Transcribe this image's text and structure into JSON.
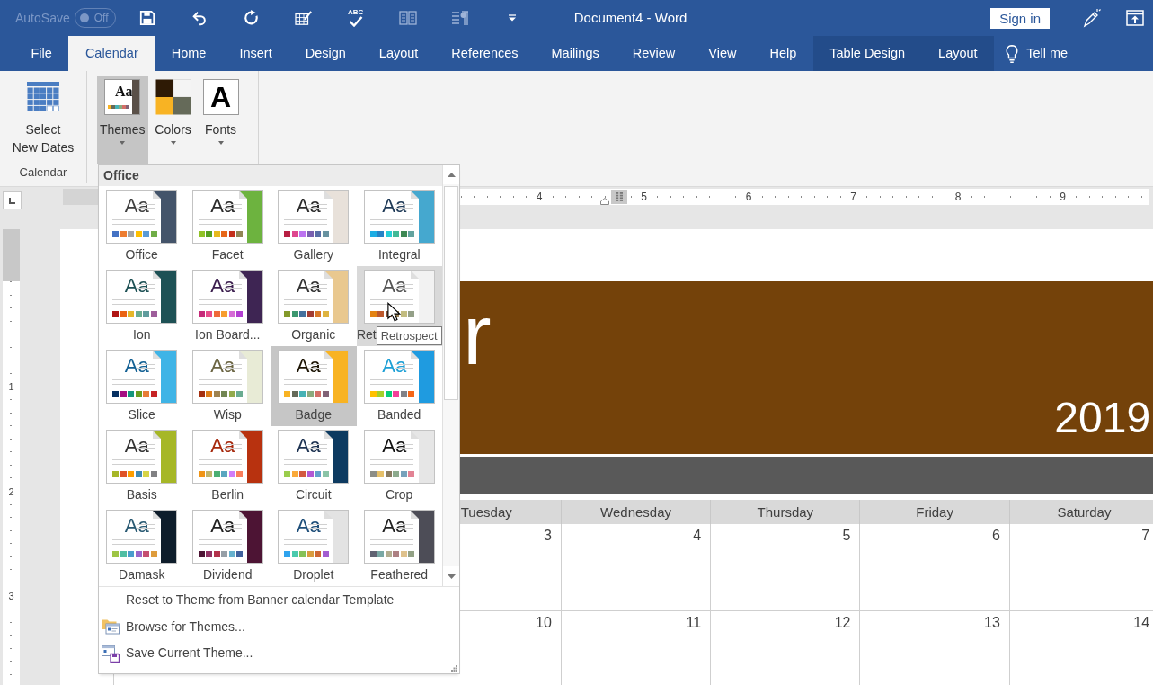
{
  "title_bar": {
    "autosave": {
      "label": "AutoSave",
      "state_text": "Off",
      "on": false,
      "disabled": true
    },
    "quick_access": [
      {
        "kind": "save",
        "disabled": false
      },
      {
        "kind": "undo",
        "disabled": false
      },
      {
        "kind": "redo",
        "disabled": false
      },
      {
        "kind": "draw-table",
        "disabled": false
      },
      {
        "kind": "spelling",
        "text": "ABC",
        "disabled": false
      },
      {
        "kind": "reading-mode",
        "disabled": true
      },
      {
        "kind": "paragraph",
        "disabled": true
      },
      {
        "kind": "customize",
        "disabled": false
      }
    ],
    "title": "Document4 - Word",
    "sign_in": "Sign in"
  },
  "tabs": [
    {
      "label": "File",
      "selected": false,
      "contextual": false
    },
    {
      "label": "Calendar",
      "selected": true,
      "contextual": false
    },
    {
      "label": "Home",
      "selected": false,
      "contextual": false
    },
    {
      "label": "Insert",
      "selected": false,
      "contextual": false
    },
    {
      "label": "Design",
      "selected": false,
      "contextual": false
    },
    {
      "label": "Layout",
      "selected": false,
      "contextual": false
    },
    {
      "label": "References",
      "selected": false,
      "contextual": false
    },
    {
      "label": "Mailings",
      "selected": false,
      "contextual": false
    },
    {
      "label": "Review",
      "selected": false,
      "contextual": false
    },
    {
      "label": "View",
      "selected": false,
      "contextual": false
    },
    {
      "label": "Help",
      "selected": false,
      "contextual": false
    },
    {
      "label": "Table Design",
      "selected": false,
      "contextual": true
    },
    {
      "label": "Layout",
      "selected": false,
      "contextual": true
    }
  ],
  "tell_me": "Tell me",
  "ribbon": {
    "groups": [
      {
        "label": "Calendar",
        "buttons": [
          {
            "kind": "calendar",
            "label": "Select\nNew Dates",
            "selected": false,
            "dropdown": false
          }
        ]
      },
      {
        "buttons": [
          {
            "kind": "themes",
            "label": "Themes",
            "icon_text": "Aa",
            "selected": true,
            "dropdown": true
          },
          {
            "kind": "colors",
            "label": "Colors",
            "selected": false,
            "dropdown": true
          },
          {
            "kind": "fonts",
            "label": "Fonts",
            "icon_text": "A",
            "selected": false,
            "dropdown": true
          }
        ]
      }
    ]
  },
  "rulers": {
    "horizontal": [
      "4",
      "5",
      "6",
      "7",
      "8",
      "9"
    ],
    "vertical": [
      "1",
      "2",
      "3"
    ]
  },
  "document": {
    "calendar": {
      "month_title": "r",
      "year": "2019",
      "weekdays": [
        "Tuesday",
        "Wednesday",
        "Thursday",
        "Friday",
        "Saturday"
      ],
      "weeks": [
        [
          "3",
          "4",
          "5",
          "6",
          "7"
        ],
        [
          "10",
          "11",
          "12",
          "13",
          "14"
        ]
      ]
    }
  },
  "themes_menu": {
    "section": "Office",
    "themes": [
      {
        "name": "Office",
        "sample": {
          "text": "Aa",
          "color": "#404040"
        },
        "accent": {
          "color": "#44546a"
        },
        "swatches": [
          {
            "color": "#4472c4"
          },
          {
            "color": "#ed7d31"
          },
          {
            "color": "#a5a5a5"
          },
          {
            "color": "#ffc000"
          },
          {
            "color": "#5b9bd5"
          },
          {
            "color": "#70ad47"
          }
        ],
        "selected": false,
        "hovered": false
      },
      {
        "name": "Facet",
        "sample": {
          "text": "Aa",
          "color": "#2c2c2c"
        },
        "accent": {
          "color": "#6db33f"
        },
        "swatches": [
          {
            "color": "#90c226"
          },
          {
            "color": "#54a021"
          },
          {
            "color": "#e6b91e"
          },
          {
            "color": "#e76618"
          },
          {
            "color": "#c42f1a"
          },
          {
            "color": "#918655"
          }
        ],
        "selected": false,
        "hovered": false
      },
      {
        "name": "Gallery",
        "sample": {
          "text": "Aa",
          "color": "#2c2c2c"
        },
        "accent": {
          "color": "#e8e1da"
        },
        "swatches": [
          {
            "color": "#b71e42"
          },
          {
            "color": "#de478e"
          },
          {
            "color": "#bc72f0"
          },
          {
            "color": "#795faf"
          },
          {
            "color": "#586ea6"
          },
          {
            "color": "#6892a0"
          }
        ],
        "selected": false,
        "hovered": false
      },
      {
        "name": "Integral",
        "sample": {
          "text": "Aa",
          "color": "#1f3a57"
        },
        "accent": {
          "color": "#45a8cf"
        },
        "swatches": [
          {
            "color": "#1cade4"
          },
          {
            "color": "#2683c6"
          },
          {
            "color": "#27ced7"
          },
          {
            "color": "#42ba97"
          },
          {
            "color": "#3e8853"
          },
          {
            "color": "#62a39f"
          }
        ],
        "selected": false,
        "hovered": false
      },
      {
        "name": "Ion",
        "sample": {
          "text": "Aa",
          "color": "#1e5155"
        },
        "accent": {
          "color": "#1e5155"
        },
        "swatches": [
          {
            "color": "#b01513"
          },
          {
            "color": "#ea6312"
          },
          {
            "color": "#e6b729"
          },
          {
            "color": "#6aac90"
          },
          {
            "color": "#5f9c9d"
          },
          {
            "color": "#9e5e9b"
          }
        ],
        "selected": false,
        "hovered": false
      },
      {
        "name": "Ion Board...",
        "sample": {
          "text": "Aa",
          "color": "#3b1e4e"
        },
        "accent": {
          "color": "#3e2553"
        },
        "swatches": [
          {
            "color": "#c62a79"
          },
          {
            "color": "#e84c8b"
          },
          {
            "color": "#ef6a3a"
          },
          {
            "color": "#f79d2e"
          },
          {
            "color": "#d66bd6"
          },
          {
            "color": "#b33fd2"
          }
        ],
        "selected": false,
        "hovered": false
      },
      {
        "name": "Organic",
        "sample": {
          "text": "Aa",
          "color": "#333333"
        },
        "accent": {
          "color": "#e9c88f"
        },
        "swatches": [
          {
            "color": "#83992a"
          },
          {
            "color": "#3c9770"
          },
          {
            "color": "#44709d"
          },
          {
            "color": "#a23c33"
          },
          {
            "color": "#d97828"
          },
          {
            "color": "#deb340"
          }
        ],
        "selected": false,
        "hovered": false
      },
      {
        "name": "Ret",
        "sample": {
          "text": "Aa",
          "color": "#555555"
        },
        "accent": {
          "color": "#f2f2f2"
        },
        "swatches": [
          {
            "color": "#e48312"
          },
          {
            "color": "#bd582c"
          },
          {
            "color": "#865640"
          },
          {
            "color": "#9b8357"
          },
          {
            "color": "#c2bc80"
          },
          {
            "color": "#94a088"
          }
        ],
        "selected": false,
        "hovered": true
      },
      {
        "name": "Slice",
        "sample": {
          "text": "Aa",
          "color": "#146194"
        },
        "accent": {
          "color": "#3fb4e6"
        },
        "swatches": [
          {
            "color": "#052f61"
          },
          {
            "color": "#a50e82"
          },
          {
            "color": "#14967c"
          },
          {
            "color": "#6a9e1f"
          },
          {
            "color": "#e87d37"
          },
          {
            "color": "#c62324"
          }
        ],
        "selected": false,
        "hovered": false
      },
      {
        "name": "Wisp",
        "sample": {
          "text": "Aa",
          "color": "#6b6543"
        },
        "accent": {
          "color": "#e8ebd6"
        },
        "swatches": [
          {
            "color": "#a53010"
          },
          {
            "color": "#de7e18"
          },
          {
            "color": "#9f8351"
          },
          {
            "color": "#728653"
          },
          {
            "color": "#92aa4c"
          },
          {
            "color": "#6aac91"
          }
        ],
        "selected": false,
        "hovered": false
      },
      {
        "name": "Badge",
        "sample": {
          "text": "Aa",
          "color": "#1c1404"
        },
        "accent": {
          "color": "#f8b323"
        },
        "swatches": [
          {
            "color": "#f8b323"
          },
          {
            "color": "#656a59"
          },
          {
            "color": "#46b2b5"
          },
          {
            "color": "#8caa7e"
          },
          {
            "color": "#d36f68"
          },
          {
            "color": "#826276"
          }
        ],
        "selected": true,
        "hovered": false
      },
      {
        "name": "Banded",
        "sample": {
          "text": "Aa",
          "color": "#1ea0d6"
        },
        "accent": {
          "color": "#1f9be0"
        },
        "swatches": [
          {
            "color": "#ffc000"
          },
          {
            "color": "#a5d028"
          },
          {
            "color": "#08cc78"
          },
          {
            "color": "#f24099"
          },
          {
            "color": "#828288"
          },
          {
            "color": "#f56617"
          }
        ],
        "selected": false,
        "hovered": false
      },
      {
        "name": "Basis",
        "sample": {
          "text": "Aa",
          "color": "#333333"
        },
        "accent": {
          "color": "#a6b727"
        },
        "swatches": [
          {
            "color": "#a6b727"
          },
          {
            "color": "#df5327"
          },
          {
            "color": "#fe9e00"
          },
          {
            "color": "#418ab3"
          },
          {
            "color": "#d7d447"
          },
          {
            "color": "#818183"
          }
        ],
        "selected": false,
        "hovered": false
      },
      {
        "name": "Berlin",
        "sample": {
          "text": "Aa",
          "color": "#a6290d"
        },
        "accent": {
          "color": "#b8320f"
        },
        "swatches": [
          {
            "color": "#f09415"
          },
          {
            "color": "#c1b56b"
          },
          {
            "color": "#4baf73"
          },
          {
            "color": "#5aa6c0"
          },
          {
            "color": "#d17df9"
          },
          {
            "color": "#fa7e5c"
          }
        ],
        "selected": false,
        "hovered": false
      },
      {
        "name": "Circuit",
        "sample": {
          "text": "Aa",
          "color": "#1d3251"
        },
        "accent": {
          "color": "#0d3a60"
        },
        "swatches": [
          {
            "color": "#9acd4c"
          },
          {
            "color": "#faa93a"
          },
          {
            "color": "#d35940"
          },
          {
            "color": "#b258d3"
          },
          {
            "color": "#63a0cc"
          },
          {
            "color": "#8ac4a7"
          }
        ],
        "selected": false,
        "hovered": false
      },
      {
        "name": "Crop",
        "sample": {
          "text": "Aa",
          "color": "#111111"
        },
        "accent": {
          "color": "#e6e6e6"
        },
        "swatches": [
          {
            "color": "#8c8d86"
          },
          {
            "color": "#e6c069"
          },
          {
            "color": "#897b61"
          },
          {
            "color": "#8dab8e"
          },
          {
            "color": "#77a2bb"
          },
          {
            "color": "#e28394"
          }
        ],
        "selected": false,
        "hovered": false
      },
      {
        "name": "Damask",
        "sample": {
          "text": "Aa",
          "color": "#2a5a73"
        },
        "accent": {
          "color": "#0e1d2b"
        },
        "swatches": [
          {
            "color": "#9ec544"
          },
          {
            "color": "#50bea3"
          },
          {
            "color": "#4a9ccc"
          },
          {
            "color": "#9a66ca"
          },
          {
            "color": "#c54f71"
          },
          {
            "color": "#de9c3c"
          }
        ],
        "selected": false,
        "hovered": false
      },
      {
        "name": "Dividend",
        "sample": {
          "text": "Aa",
          "color": "#222222"
        },
        "accent": {
          "color": "#4d1434"
        },
        "swatches": [
          {
            "color": "#4d1434"
          },
          {
            "color": "#903163"
          },
          {
            "color": "#b2324b"
          },
          {
            "color": "#969fa7"
          },
          {
            "color": "#66b1ce"
          },
          {
            "color": "#40619d"
          }
        ],
        "selected": false,
        "hovered": false
      },
      {
        "name": "Droplet",
        "sample": {
          "text": "Aa",
          "color": "#1e4e79"
        },
        "accent": {
          "color": "#e3e3e3"
        },
        "swatches": [
          {
            "color": "#2fa3ee"
          },
          {
            "color": "#4bcaad"
          },
          {
            "color": "#86c157"
          },
          {
            "color": "#d99c3f"
          },
          {
            "color": "#ce6633"
          },
          {
            "color": "#a35dd1"
          }
        ],
        "selected": false,
        "hovered": false
      },
      {
        "name": "Feathered",
        "sample": {
          "text": "Aa",
          "color": "#222222"
        },
        "accent": {
          "color": "#4d4d57"
        },
        "swatches": [
          {
            "color": "#606372"
          },
          {
            "color": "#79a8a4"
          },
          {
            "color": "#b2ad8f"
          },
          {
            "color": "#ad8082"
          },
          {
            "color": "#dec18c"
          },
          {
            "color": "#92a185"
          }
        ],
        "selected": false,
        "hovered": false
      }
    ],
    "tooltip": "Retrospect",
    "actions": [
      {
        "kind": "reset",
        "label": "Reset to Theme from Banner calendar Template"
      },
      {
        "kind": "browse",
        "label": "Browse for Themes..."
      },
      {
        "kind": "save",
        "label": "Save Current Theme..."
      }
    ]
  }
}
